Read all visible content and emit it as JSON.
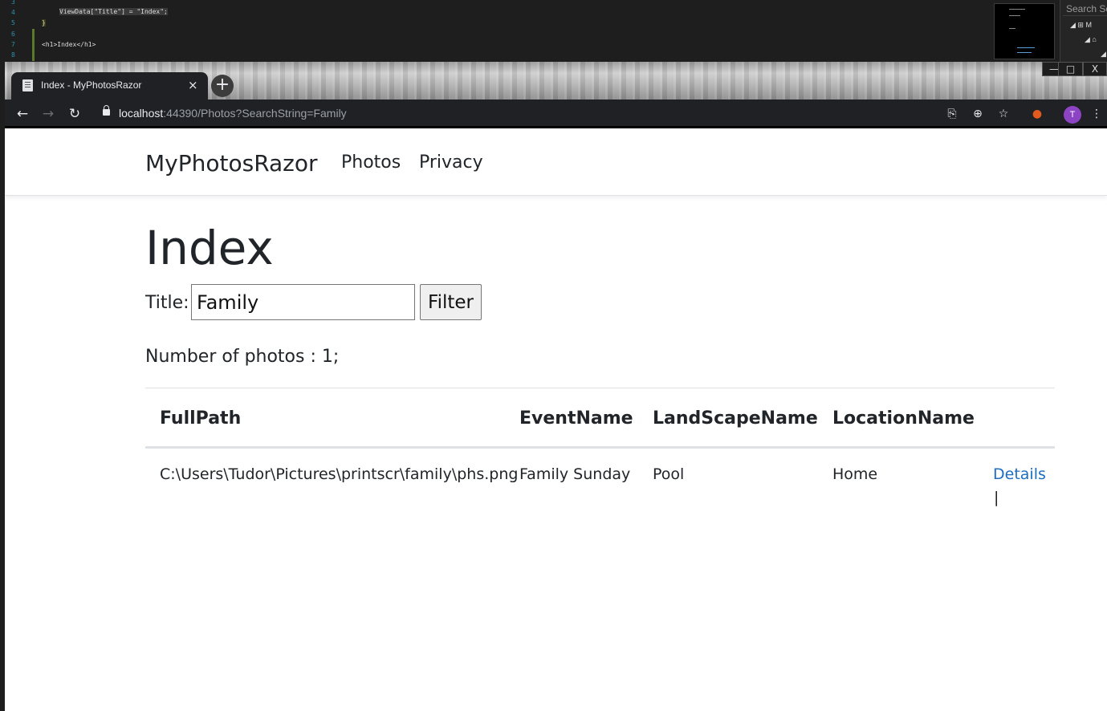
{
  "editor": {
    "line_numbers": [
      "3",
      "4",
      "5",
      "6",
      "7",
      "8"
    ],
    "code_lines": [
      "",
      "ViewData[\"Title\"] = \"Index\";",
      "}",
      "",
      "<h1>Index</h1>",
      ""
    ],
    "solution_search": "Search Sol"
  },
  "browser": {
    "tab_title": "Index - MyPhotosRazor",
    "tab_close": "×",
    "new_tab": "+",
    "window_controls": {
      "minimize": "—",
      "maximize": "□",
      "close": "X"
    },
    "nav": {
      "back": "←",
      "forward": "→",
      "reload": "↻"
    },
    "url_host": "localhost",
    "url_rest": ":44390/Photos?SearchString=Family",
    "avatar_initial": "T",
    "toolbar_icons": {
      "translate": "⎘",
      "zoom": "⊕",
      "bookmark": "☆",
      "extension": "●",
      "menu": "⋮"
    }
  },
  "site": {
    "brand": "MyPhotosRazor",
    "nav_links": [
      "Photos",
      "Privacy"
    ]
  },
  "main": {
    "heading": "Index",
    "filter_label": "Title:",
    "filter_value": "Family",
    "filter_button": "Filter",
    "count_text": "Number of photos : 1;"
  },
  "table": {
    "headers": [
      "FullPath",
      "EventName",
      "LandScapeName",
      "LocationName"
    ],
    "rows": [
      {
        "full_path": "C:\\Users\\Tudor\\Pictures\\printscr\\family\\phs.png",
        "event_name": "Family Sunday",
        "landscape_name": "Pool",
        "location_name": "Home",
        "action_label": "Details",
        "separator": "|"
      }
    ]
  },
  "colors": {
    "link": "#1b6ec2",
    "text": "#212529",
    "border": "#dee2e6",
    "chrome_dark": "#202124",
    "avatar": "#8c44c4"
  }
}
